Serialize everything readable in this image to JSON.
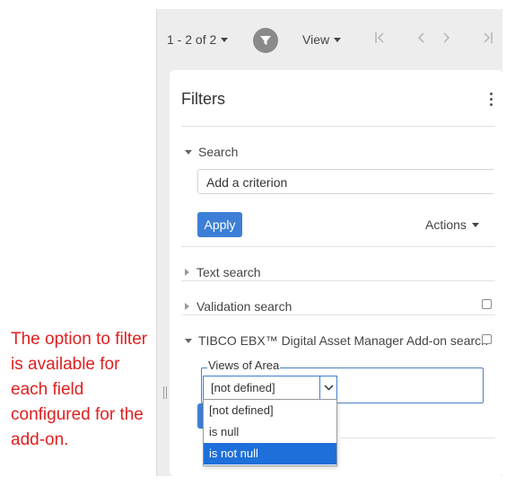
{
  "annotation": {
    "text": "The option to filter is available for each field configured for the add-on."
  },
  "toolbar": {
    "pager_label": "1 - 2 of 2",
    "view_label": "View",
    "first_icon": "first-page-icon",
    "prev_icon": "prev-page-icon",
    "next_icon": "next-page-icon",
    "last_icon": "last-page-icon",
    "filter_icon": "funnel-icon"
  },
  "filters": {
    "title": "Filters",
    "menu_icon": "kebab-icon",
    "search": {
      "label": "Search",
      "criterion_placeholder": "Add a criterion",
      "apply_label": "Apply",
      "actions_label": "Actions"
    },
    "sections": [
      {
        "label": "Text search",
        "expanded": false,
        "checkbox": false
      },
      {
        "label": "Validation search",
        "expanded": false,
        "checkbox": true
      },
      {
        "label": "TIBCO EBX™ Digital Asset Manager Add-on search",
        "expanded": true,
        "checkbox": true
      }
    ],
    "dam": {
      "field_label": "Views of Area",
      "selected_value": "[not defined]",
      "options": [
        "[not defined]",
        "is null",
        "is not null"
      ],
      "highlighted_option": "is not null"
    }
  },
  "colors": {
    "accent": "#3d7fd6",
    "highlight": "#1e6fd9",
    "annotation": "#e02020"
  }
}
